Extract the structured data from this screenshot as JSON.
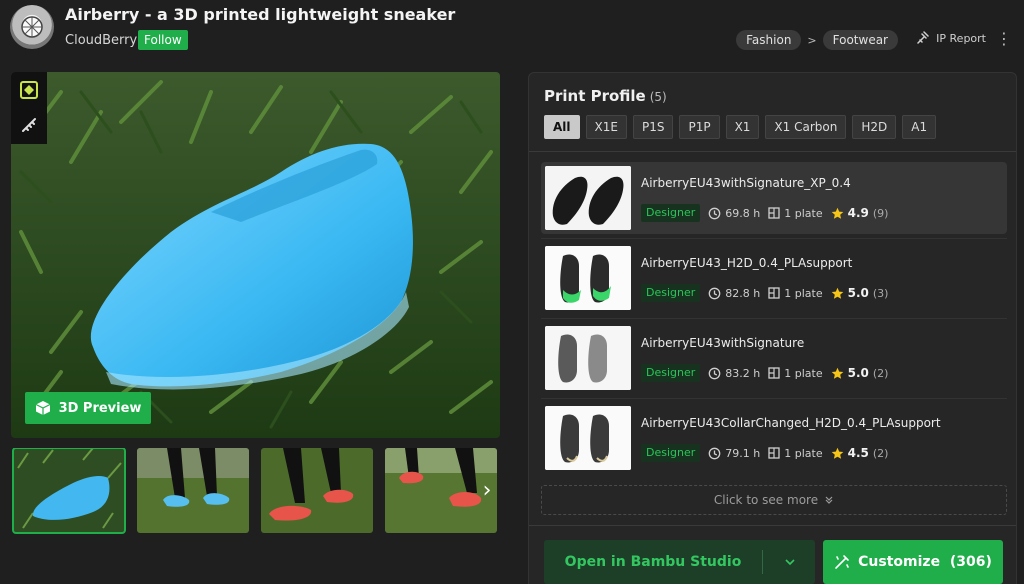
{
  "header": {
    "title": "Airberry - a 3D printed lightweight sneaker",
    "author": "CloudBerry",
    "follow_label": "Follow",
    "breadcrumbs": [
      "Fashion",
      "Footwear"
    ],
    "breadcrumb_separator": ">",
    "ip_report_label": "IP Report",
    "more_icon": "more-vertical-icon"
  },
  "gallery": {
    "preview_button_label": "3D Preview",
    "thumbnail_count": 4,
    "active_thumbnail": 0
  },
  "print_profile": {
    "title": "Print Profile",
    "count": "(5)",
    "filters": [
      "All",
      "X1E",
      "P1S",
      "P1P",
      "X1",
      "X1 Carbon",
      "H2D",
      "A1"
    ],
    "active_filter": "All",
    "items": [
      {
        "name": "AirberryEU43withSignature_XP_0.4",
        "badge": "Designer",
        "time": "69.8 h",
        "plates": "1 plate",
        "rating": "4.9",
        "reviews": "(9)"
      },
      {
        "name": "AirberryEU43_H2D_0.4_PLAsupport",
        "badge": "Designer",
        "time": "82.8 h",
        "plates": "1 plate",
        "rating": "5.0",
        "reviews": "(3)"
      },
      {
        "name": "AirberryEU43withSignature",
        "badge": "Designer",
        "time": "83.2 h",
        "plates": "1 plate",
        "rating": "5.0",
        "reviews": "(2)"
      },
      {
        "name": "AirberryEU43CollarChanged_H2D_0.4_PLAsupport",
        "badge": "Designer",
        "time": "79.1 h",
        "plates": "1 plate",
        "rating": "4.5",
        "reviews": "(2)"
      }
    ],
    "see_more_label": "Click to see more",
    "open_button_label": "Open in Bambu Studio",
    "customize_button_label": "Customize  (306)"
  },
  "colors": {
    "accent": "#1fae4a",
    "background": "#1f1f1f",
    "panel": "#262626",
    "star": "#f5c518"
  }
}
